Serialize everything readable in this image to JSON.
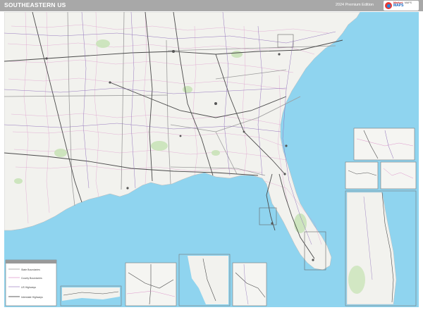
{
  "header": {
    "title": "SOUTHEASTERN US",
    "edition": "2024 Premium Edition"
  },
  "logo": {
    "brand_top": "Market",
    "brand_main": "MAPS",
    "tagline": "MAPS"
  },
  "colors": {
    "header": "#a8a8a8",
    "water": "#8fd4ef",
    "land": "#f2f2ee",
    "interstate": "#4a4a4a",
    "county_line": "#d77fc1",
    "highway": "#8c6bb8",
    "park": "#c9e3b8"
  },
  "inset_count": 9,
  "legend": {
    "title": "",
    "rows": [
      "State Boundaries",
      "County Boundaries",
      "US Highways",
      "Interstate Highways"
    ]
  }
}
